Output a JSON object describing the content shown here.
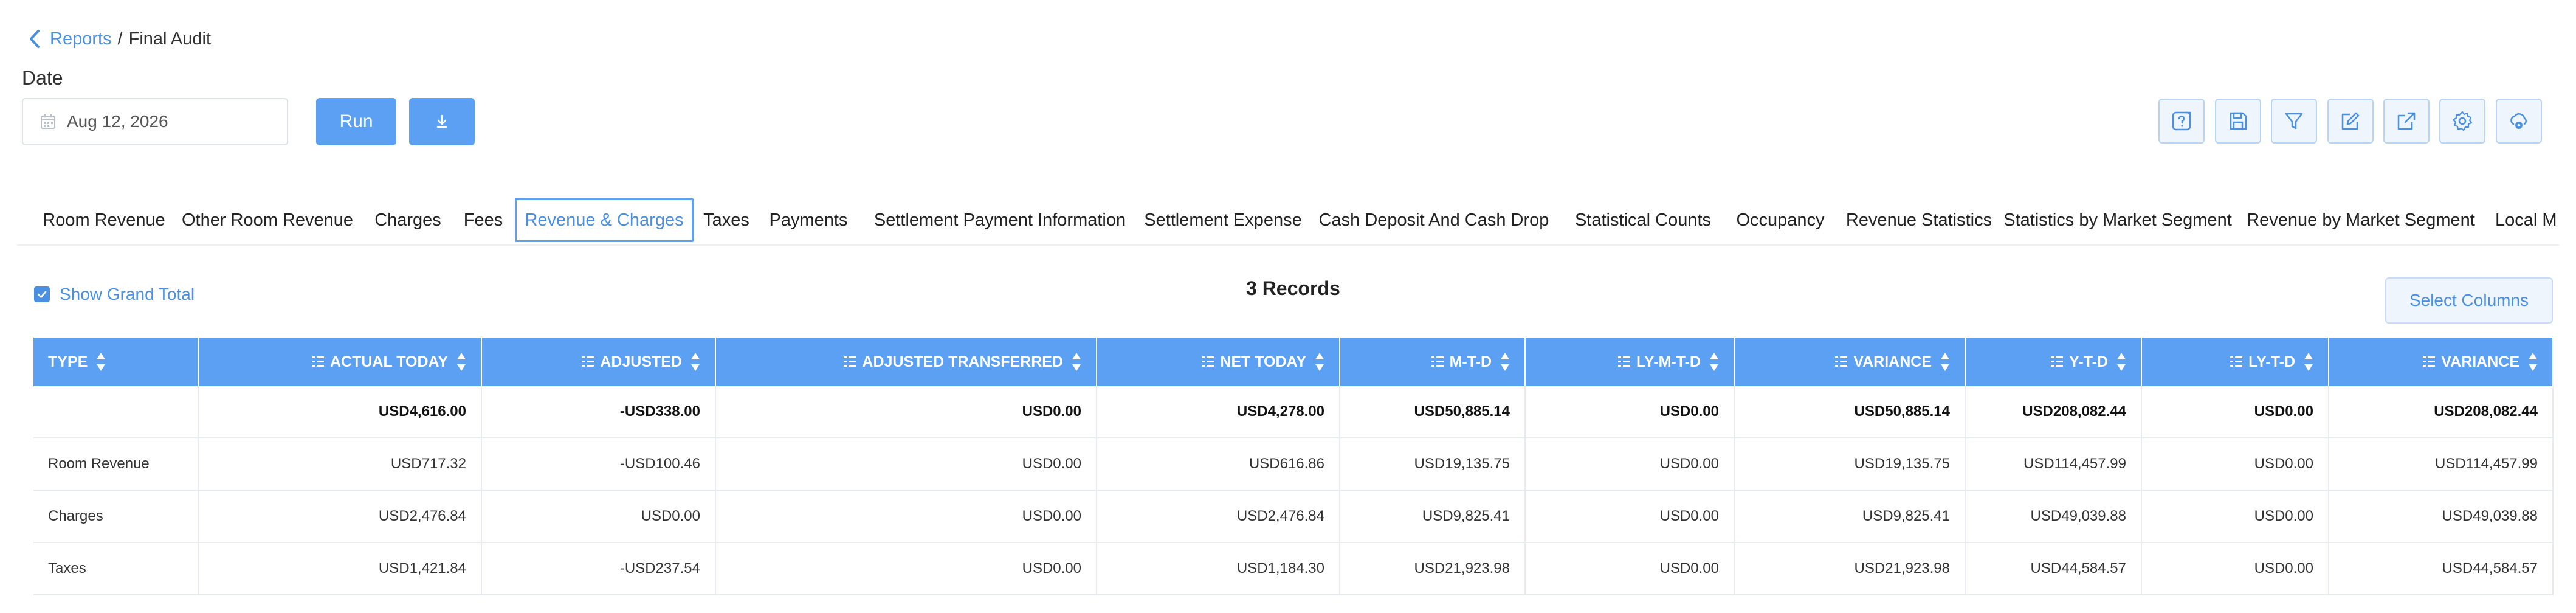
{
  "breadcrumb": {
    "parent": "Reports",
    "separator": "/",
    "current": "Final Audit"
  },
  "date": {
    "label": "Date",
    "value": "Aug 12, 2026"
  },
  "actions": {
    "run_label": "Run"
  },
  "toolbar": [
    {
      "name": "help-report-icon"
    },
    {
      "name": "save-icon"
    },
    {
      "name": "filter-icon"
    },
    {
      "name": "edit-icon"
    },
    {
      "name": "export-icon"
    },
    {
      "name": "settings-icon"
    },
    {
      "name": "cloud-settings-icon"
    }
  ],
  "tabs": [
    {
      "label": "Room Revenue"
    },
    {
      "label": "Other Room Revenue"
    },
    {
      "label": "Charges"
    },
    {
      "label": "Fees"
    },
    {
      "label": "Revenue & Charges",
      "active": true
    },
    {
      "label": "Taxes"
    },
    {
      "label": "Payments"
    },
    {
      "label": "Settlement Payment Information"
    },
    {
      "label": "Settlement Expense"
    },
    {
      "label": "Cash Deposit And Cash Drop"
    },
    {
      "label": "Statistical Counts"
    },
    {
      "label": "Occupancy"
    },
    {
      "label": "Revenue Statistics"
    },
    {
      "label": "Statistics by Market Segment"
    },
    {
      "label": "Revenue by Market Segment"
    },
    {
      "label": "Local M"
    }
  ],
  "grand_total_label": "Show Grand Total",
  "records_label": "3 Records",
  "select_columns_label": "Select Columns",
  "table": {
    "columns": [
      "TYPE",
      "ACTUAL TODAY",
      "ADJUSTED",
      "ADJUSTED TRANSFERRED",
      "NET TODAY",
      "M-T-D",
      "LY-M-T-D",
      "VARIANCE",
      "Y-T-D",
      "LY-T-D",
      "VARIANCE"
    ],
    "total_row": [
      "",
      "USD4,616.00",
      "-USD338.00",
      "USD0.00",
      "USD4,278.00",
      "USD50,885.14",
      "USD0.00",
      "USD50,885.14",
      "USD208,082.44",
      "USD0.00",
      "USD208,082.44"
    ],
    "rows": [
      [
        "Room Revenue",
        "USD717.32",
        "-USD100.46",
        "USD0.00",
        "USD616.86",
        "USD19,135.75",
        "USD0.00",
        "USD19,135.75",
        "USD114,457.99",
        "USD0.00",
        "USD114,457.99"
      ],
      [
        "Charges",
        "USD2,476.84",
        "USD0.00",
        "USD0.00",
        "USD2,476.84",
        "USD9,825.41",
        "USD0.00",
        "USD9,825.41",
        "USD49,039.88",
        "USD0.00",
        "USD49,039.88"
      ],
      [
        "Taxes",
        "USD1,421.84",
        "-USD237.54",
        "USD0.00",
        "USD1,184.30",
        "USD21,923.98",
        "USD0.00",
        "USD21,923.98",
        "USD44,584.57",
        "USD0.00",
        "USD44,584.57"
      ]
    ]
  },
  "colors": {
    "accent": "#5ba0f2",
    "link": "#4a90e2",
    "border": "#e8ebef"
  }
}
